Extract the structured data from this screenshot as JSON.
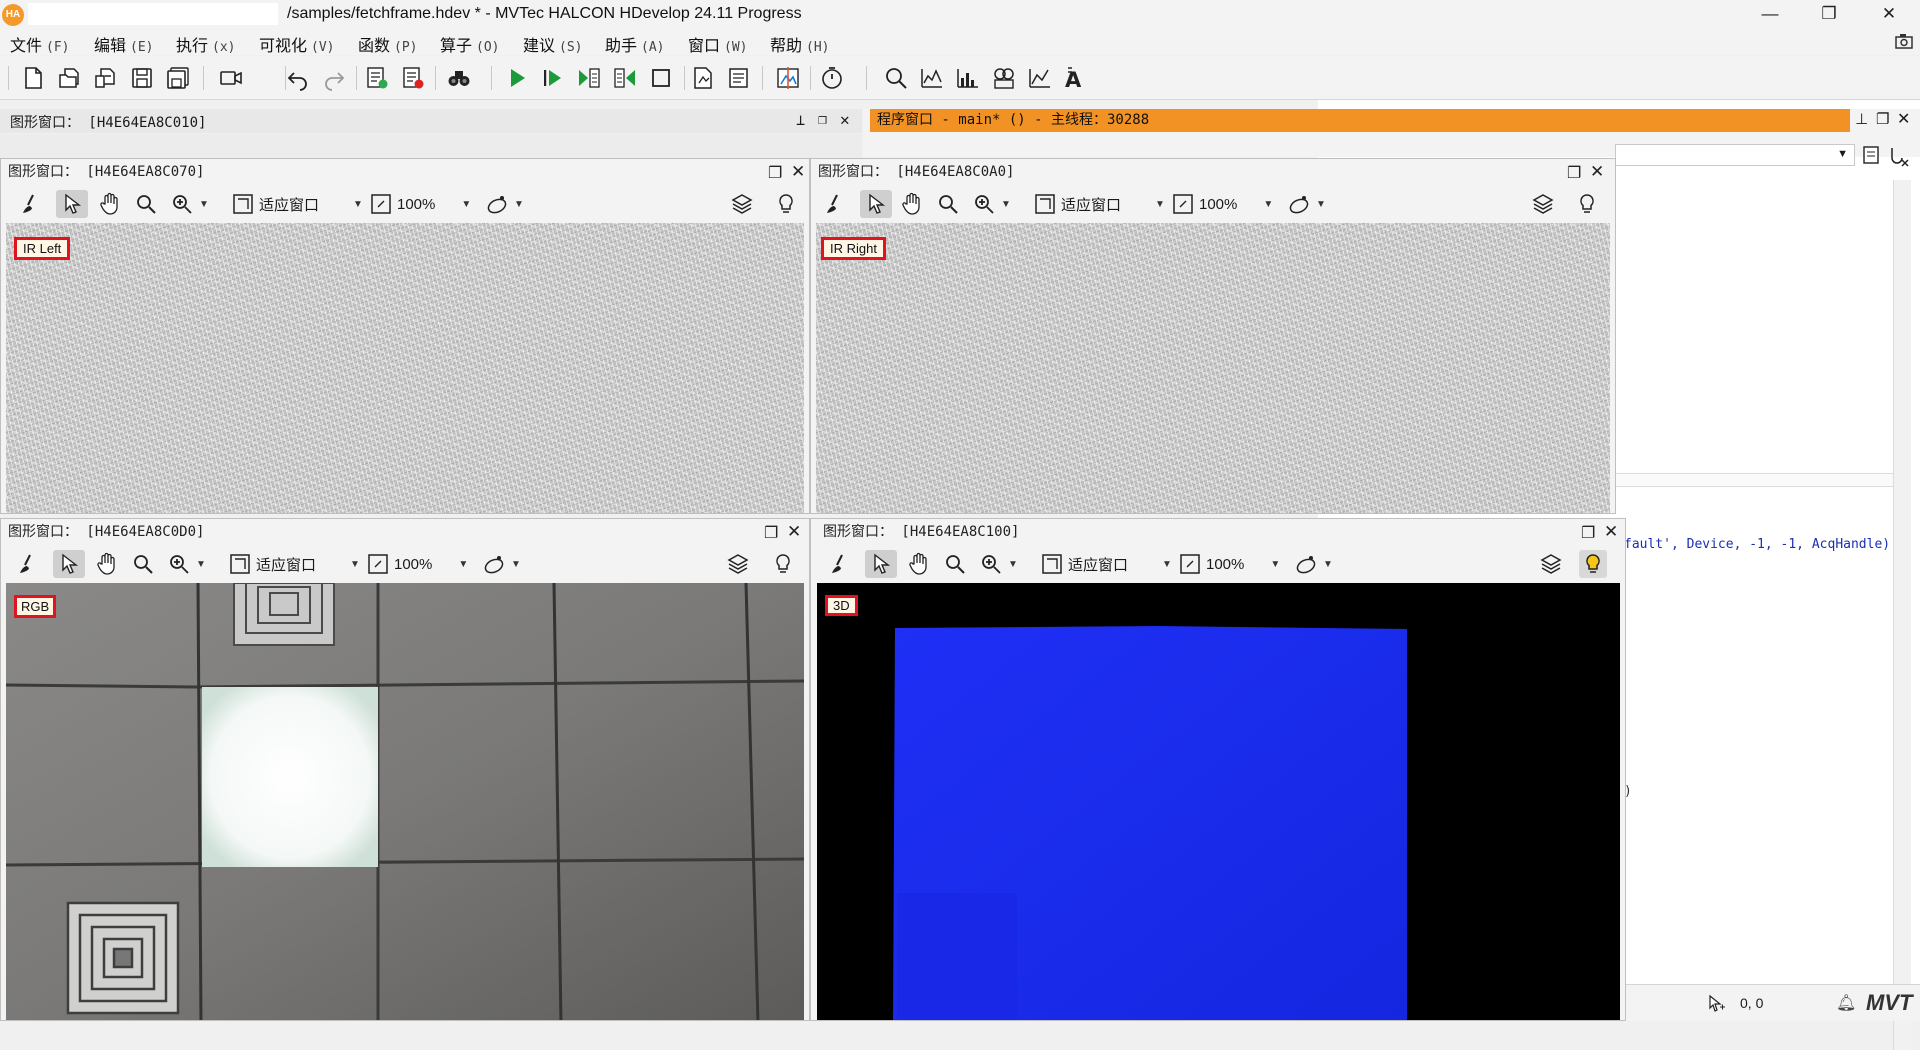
{
  "app": {
    "logo": "HA",
    "title": "/samples/fetchframe.hdev * - MVTec HALCON HDevelop 24.11 Progress"
  },
  "window_controls": {
    "minimize": "—",
    "restore": "❐",
    "close": "✕"
  },
  "menu": [
    {
      "label": "文件",
      "key": "(F)"
    },
    {
      "label": "编辑",
      "key": "(E)"
    },
    {
      "label": "执行",
      "key": "(x)"
    },
    {
      "label": "可视化",
      "key": "(V)"
    },
    {
      "label": "函数",
      "key": "(P)"
    },
    {
      "label": "算子",
      "key": "(O)"
    },
    {
      "label": "建议",
      "key": "(S)"
    },
    {
      "label": "助手",
      "key": "(A)"
    },
    {
      "label": "窗口",
      "key": "(W)"
    },
    {
      "label": "帮助",
      "key": "(H)"
    }
  ],
  "graphics_dock": {
    "title": "图形窗口： [H4E64EA8C010]"
  },
  "program_window": {
    "title": "程序窗口 - main* () - 主线程：30288",
    "code_visible": "fault', Device, -1, -1, AcqHandle)",
    "code_paren": ")"
  },
  "graphics_windows": [
    {
      "id": "gw1",
      "title": "图形窗口： [H4E64EA8C070]",
      "fit_label": "适应窗口",
      "zoom": "100%",
      "image_label": "IR Left"
    },
    {
      "id": "gw2",
      "title": "图形窗口： [H4E64EA8C0A0]",
      "fit_label": "适应窗口",
      "zoom": "100%",
      "image_label": "IR Right"
    },
    {
      "id": "gw3",
      "title": "图形窗口： [H4E64EA8C0D0]",
      "fit_label": "适应窗口",
      "zoom": "100%",
      "image_label": "RGB"
    },
    {
      "id": "gw4",
      "title": "图形窗口： [H4E64EA8C100]",
      "fit_label": "适应窗口",
      "zoom": "100%",
      "image_label": "3D"
    }
  ],
  "statusbar": {
    "coords": "0,  0",
    "brand": "MVT"
  },
  "colors": {
    "program_title_bg": "#f39224",
    "depth_blue": "#1b2cf0",
    "label_border": "#e0141e"
  }
}
